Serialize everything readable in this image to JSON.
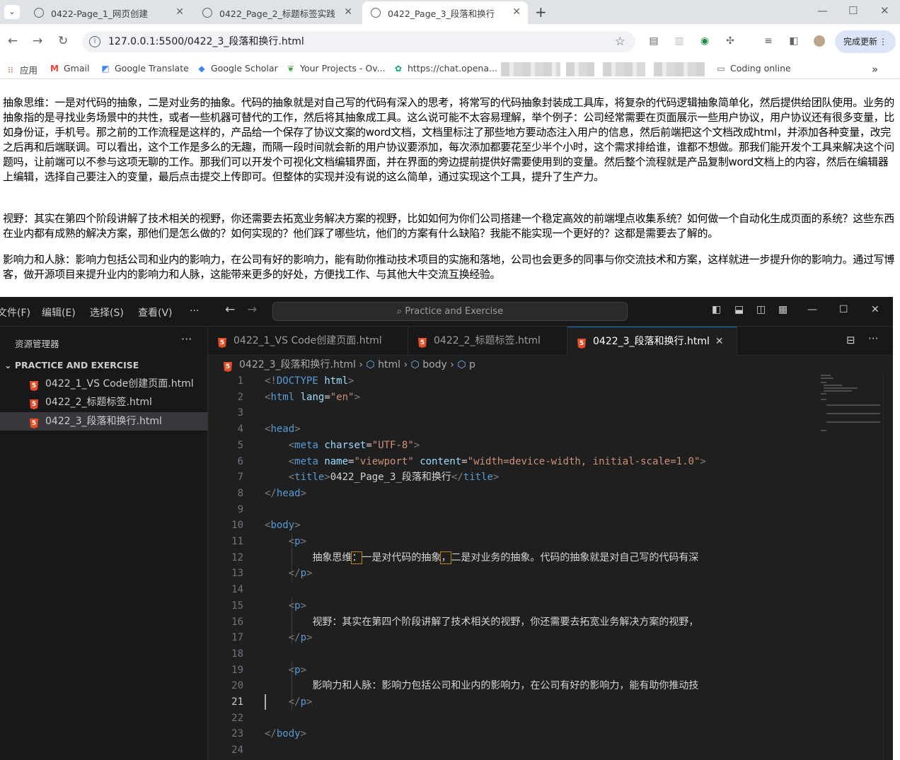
{
  "browser": {
    "tabs": [
      {
        "title": "0422-Page_1_网页创建"
      },
      {
        "title": "0422_Page_2_标题标签实践"
      },
      {
        "title": "0422_Page_3_段落和换行",
        "active": true
      }
    ],
    "url": "127.0.0.1:5500/0422_3_段落和换行.html",
    "update_label": "完成更新",
    "bookmarks": [
      {
        "label": "应用",
        "icon": "apps-grid-icon"
      },
      {
        "label": "Gmail",
        "icon": "gmail-icon"
      },
      {
        "label": "Google Translate",
        "icon": "translate-icon"
      },
      {
        "label": "Google Scholar",
        "icon": "scholar-icon"
      },
      {
        "label": "Your Projects - Ov...",
        "icon": "overleaf-icon"
      },
      {
        "label": "https://chat.opena...",
        "icon": "openai-icon"
      },
      {
        "label": "Coding online",
        "icon": "folder-icon"
      }
    ]
  },
  "page": {
    "paragraphs": [
      "抽象思维：一是对代码的抽象，二是对业务的抽象。代码的抽象就是对自己写的代码有深入的思考，将常写的代码抽象封装成工具库，将复杂的代码逻辑抽象简单化，然后提供给团队使用。业务的抽象指的是寻找业务场景中的共性，或者一些机器可替代的工作，然后将其抽象成工具。这么说可能不太容易理解，举个例子：公司经常需要在页面展示一些用户协议，用户协议还有很多变量，比如身份证，手机号。那之前的工作流程是这样的，产品给一个保存了协议文案的word文档，文档里标注了那些地方要动态注入用户的信息，然后前端把这个文档改成html，并添加各种变量，改完之后再和后端联调。可以看出，这个工作是多么的无趣，而隔一段时间就会新的用户协议要添加，每次添加都要花至少半个小时，这个需求排给谁，谁都不想做。那我们能开发个工具来解决这个问题吗，让前端可以不参与这项无聊的工作。那我们可以开发个可视化文档编辑界面，并在界面的旁边提前提供好需要使用到的变量。然后整个流程就是产品复制word文档上的内容，然后在编辑器上编辑，选择自己要注入的变量，最后点击提交上传即可。但整体的实现并没有说的这么简单，通过实现这个工具，提升了生产力。",
      "视野：其实在第四个阶段讲解了技术相关的视野，你还需要去拓宽业务解决方案的视野，比如如何为你们公司搭建一个稳定高效的前端埋点收集系统？如何做一个自动化生成页面的系统？这些东西在业内都有成熟的解决方案，那他们是怎么做的？如何实现的？他们踩了哪些坑，他们的方案有什么缺陷？我能不能实现一个更好的？这都是需要去了解的。",
      "影响力和人脉：影响力包括公司和业内的影响力，在公司有好的影响力，能有助你推动技术项目的实施和落地，公司也会更多的同事与你交流技术和方案，这样就进一步提升你的影响力。通过写博客，做开源项目来提升业内的影响力和人脉，这能带来更多的好处，方便找工作、与其他大牛交流互换经验。"
    ]
  },
  "vscode": {
    "menus": [
      "文件(F)",
      "编辑(E)",
      "选择(S)",
      "查看(V)",
      "···"
    ],
    "command_center": "Practice and Exercise",
    "explorer_title": "资源管理器",
    "folder": "PRACTICE AND EXERCISE",
    "files": [
      "0422_1_VS Code创建页面.html",
      "0422_2_标题标签.html",
      "0422_3_段落和换行.html"
    ],
    "tabs": [
      "0422_1_VS Code创建页面.html",
      "0422_2_标题标签.html",
      "0422_3_段落和换行.html"
    ],
    "breadcrumb": {
      "file": "0422_3_段落和换行.html",
      "items": [
        "html",
        "body",
        "p"
      ]
    },
    "current_line": 21,
    "code_text": {
      "doctype": "DOCTYPE",
      "html_tag": "html",
      "lang_attr": "lang",
      "lang_val": "\"en\"",
      "head": "head",
      "meta": "meta",
      "charset_attr": "charset",
      "charset_val": "\"UTF-8\"",
      "name_attr": "name",
      "name_val": "\"viewport\"",
      "content_attr": "content",
      "content_val": "\"width=device-width, initial-scale=1.0\"",
      "title": "title",
      "title_text": "0422_Page_3_段落和换行",
      "body": "body",
      "p": "p",
      "p1_a": "抽象思维",
      "p1_b": "：",
      "p1_c": "一是对代码的抽象",
      "p1_d": "，",
      "p1_e": "二是对业务的抽象。代码的抽象就是对自己写的代码有深",
      "p2": "视野：其实在第四个阶段讲解了技术相关的视野，你还需要去拓宽业务解决方案的视野，",
      "p3": "影响力和人脉：影响力包括公司和业内的影响力，在公司有好的影响力，能有助你推动技"
    }
  }
}
